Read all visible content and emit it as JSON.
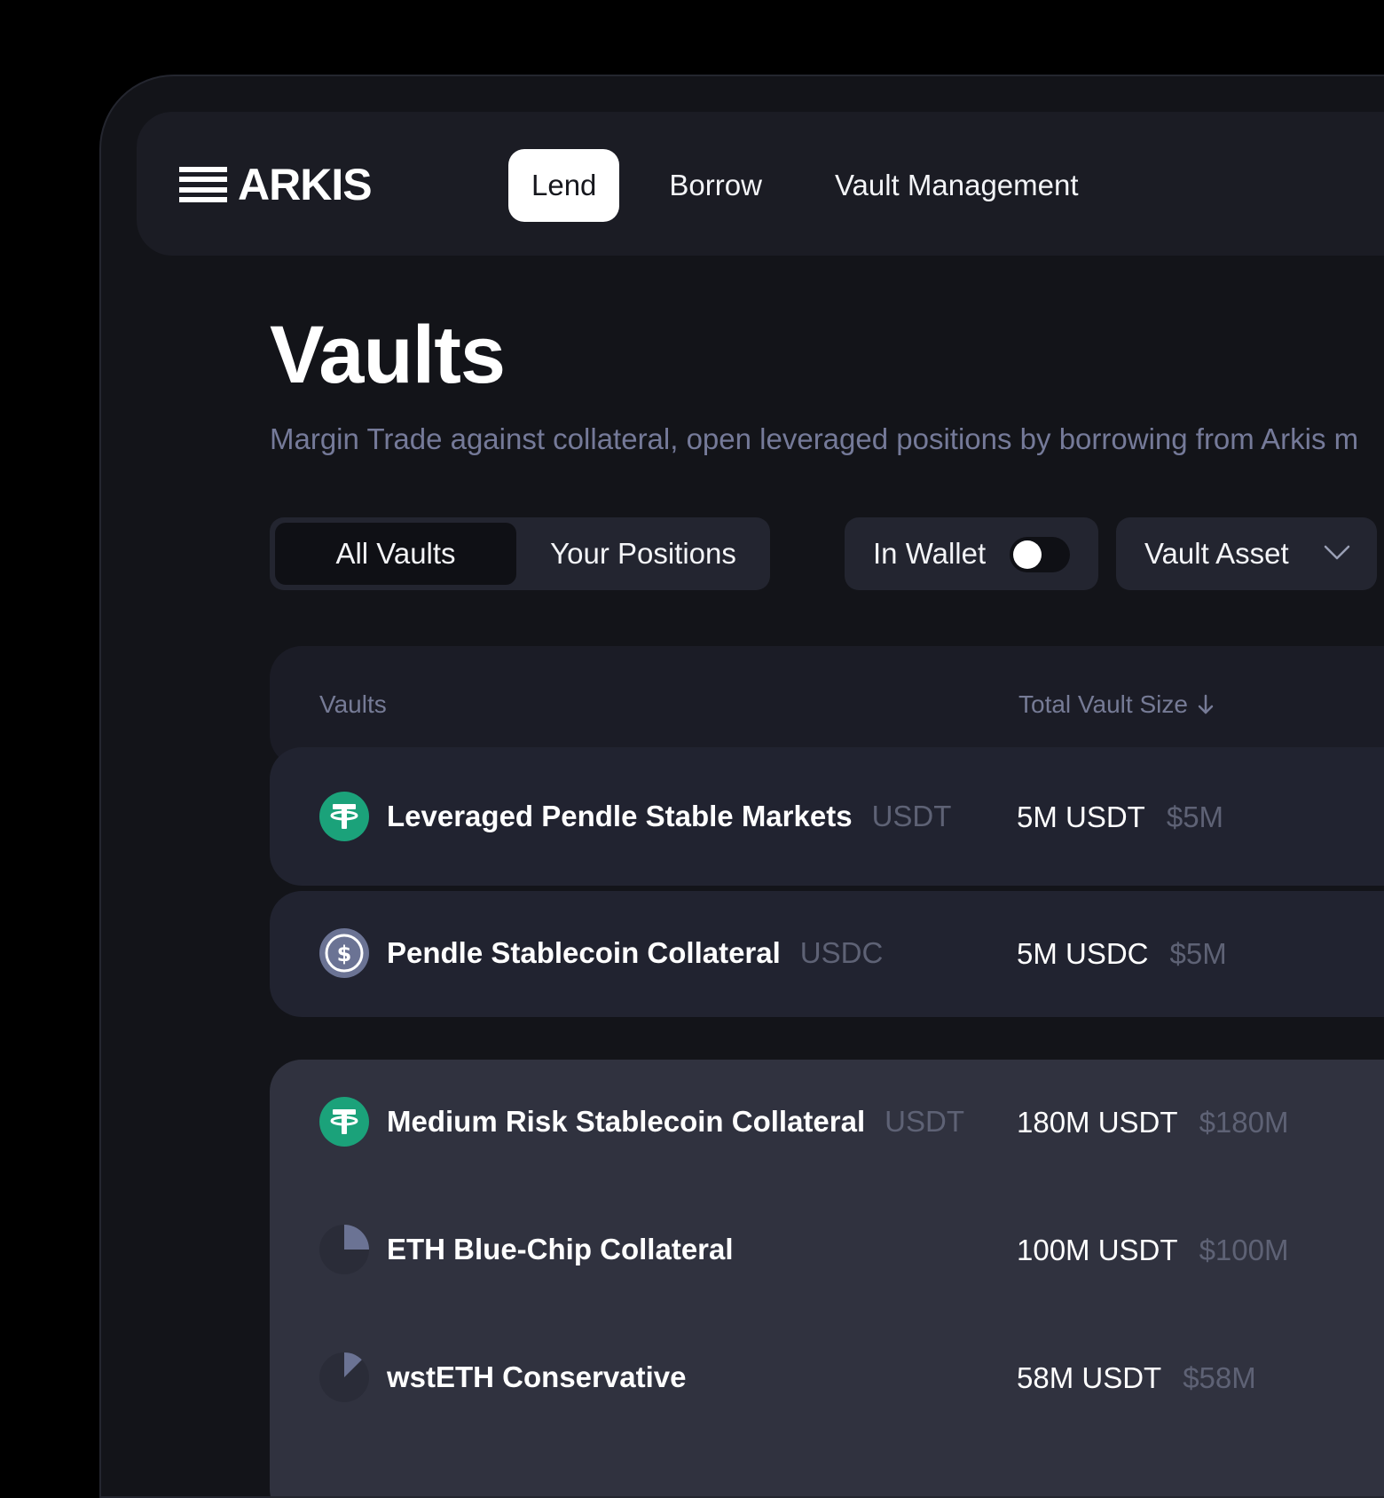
{
  "brand": {
    "name": "ARKIS"
  },
  "nav": {
    "items": [
      "Lend",
      "Borrow",
      "Vault Management"
    ],
    "active": "Lend"
  },
  "page": {
    "title": "Vaults",
    "description": "Margin Trade against collateral, open leveraged positions by borrowing from Arkis m"
  },
  "filters": {
    "segments": [
      "All Vaults",
      "Your Positions"
    ],
    "active_segment": "All Vaults",
    "wallet_toggle": {
      "label": "In Wallet",
      "on": false
    },
    "asset_select": {
      "label": "Vault Asset"
    }
  },
  "table": {
    "headers": {
      "vaults": "Vaults",
      "total_size": "Total Vault Size"
    },
    "rows": [
      {
        "name": "Leveraged Pendle Stable Markets",
        "asset": "USDT",
        "size": "5M USDT",
        "usd": "$5M",
        "icon": "tether-icon"
      },
      {
        "name": "Pendle Stablecoin Collateral",
        "asset": "USDC",
        "size": "5M USDC",
        "usd": "$5M",
        "icon": "usdc-icon"
      },
      {
        "name": "Medium Risk Stablecoin Collateral",
        "asset": "USDT",
        "size": "180M USDT",
        "usd": "$180M",
        "icon": "tether-icon"
      },
      {
        "name": "ETH Blue-Chip Collateral",
        "asset": "",
        "size": "100M USDT",
        "usd": "$100M",
        "icon": "pie-icon"
      },
      {
        "name": "wstETH Conservative",
        "asset": "",
        "size": "58M USDT",
        "usd": "$58M",
        "icon": "pie-icon"
      }
    ]
  },
  "colors": {
    "background": "#000000",
    "frame": "#131419",
    "tether": "#1ba27a",
    "usdc": "#6b7394",
    "muted_text": "#5e6275"
  }
}
